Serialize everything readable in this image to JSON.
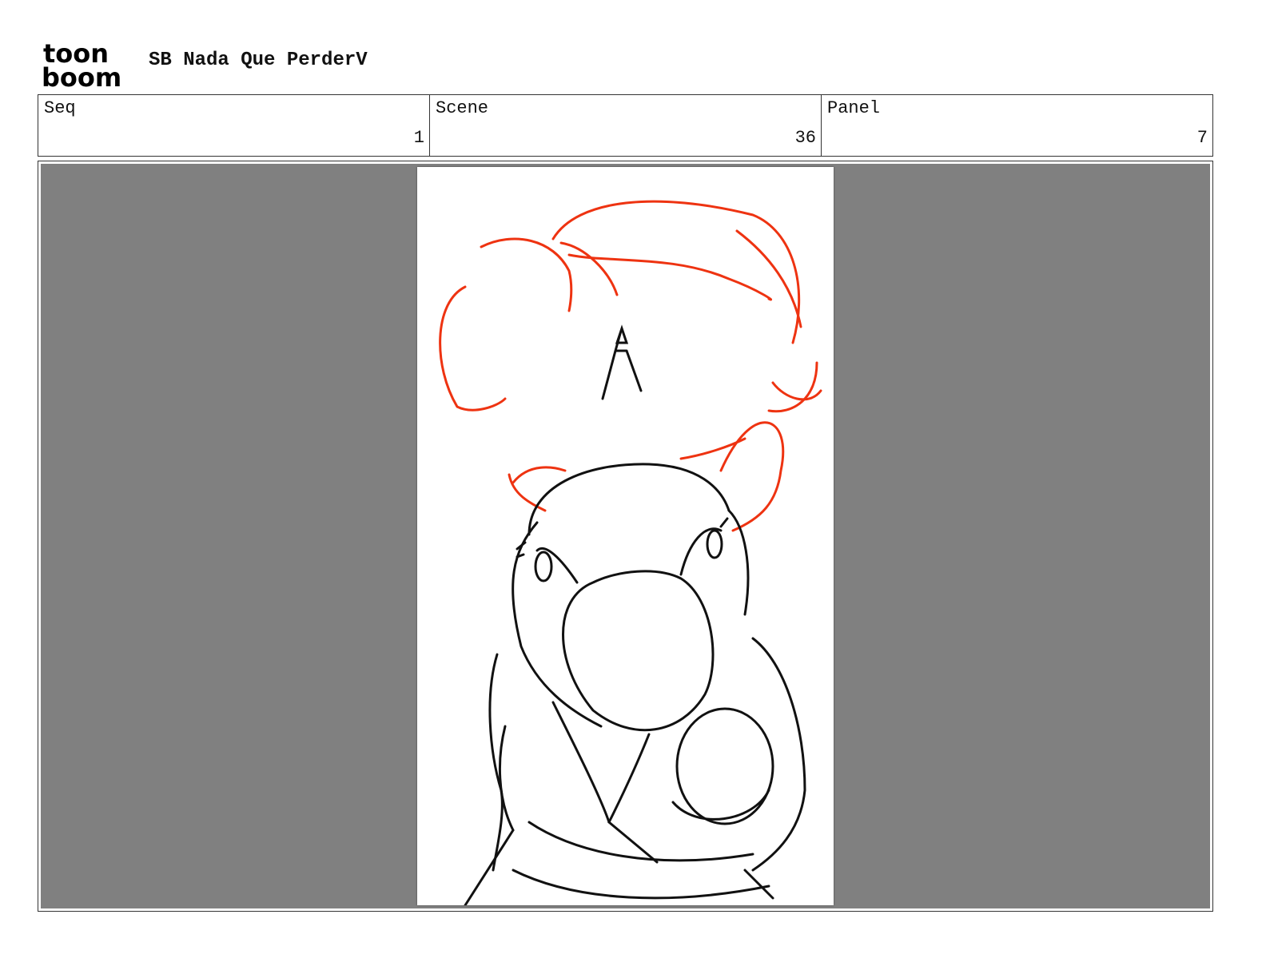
{
  "header": {
    "logo_line1": "toon",
    "logo_line2": "boom",
    "project_title": "SB Nada Que PerderV"
  },
  "info": {
    "seq_label": "Seq",
    "seq_value": "1",
    "scene_label": "Scene",
    "scene_value": "36",
    "panel_label": "Panel",
    "panel_value": "7"
  },
  "panel": {
    "background_color": "#808080",
    "sketch_colors": {
      "ink": "#111111",
      "accent": "#ee3311"
    }
  }
}
